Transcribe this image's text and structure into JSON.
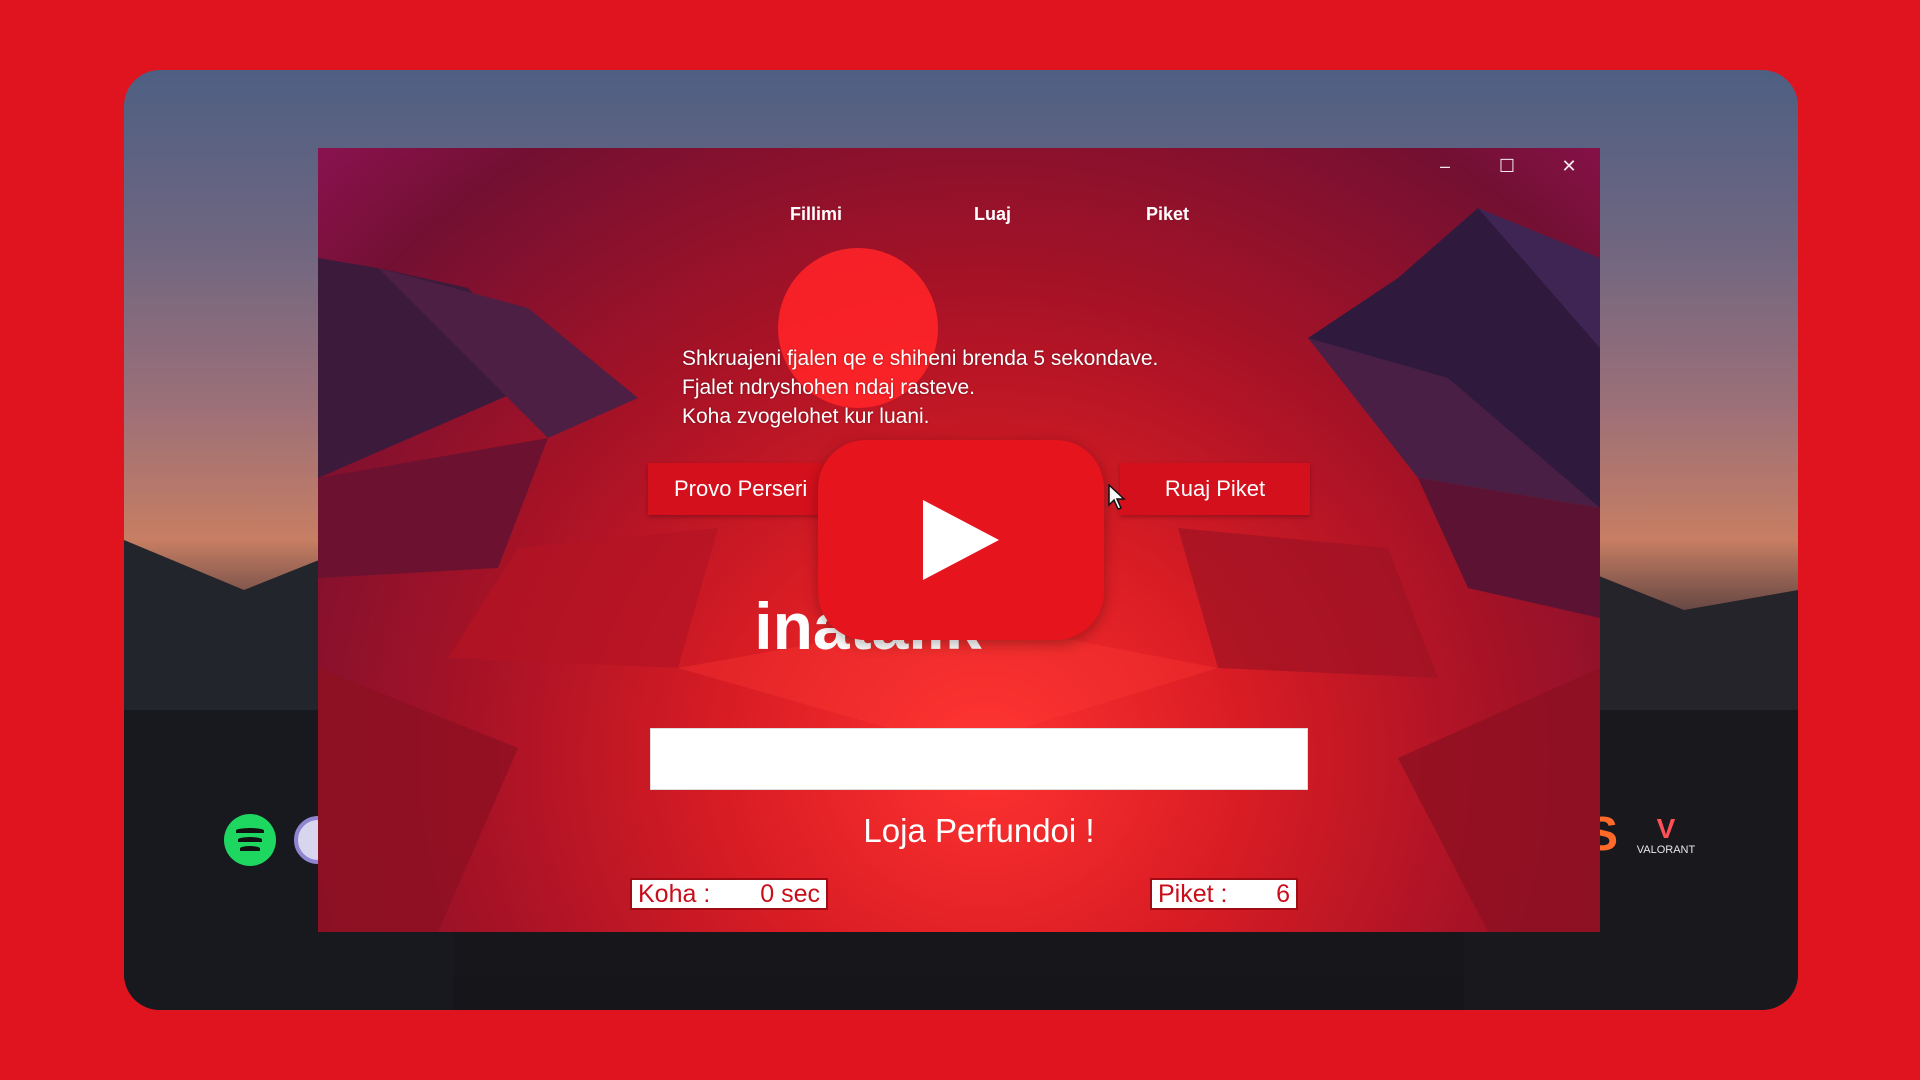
{
  "window": {
    "controls": {
      "minimize": "–",
      "maximize": "☐",
      "close": "✕"
    },
    "nav": [
      "Fillimi",
      "Luaj",
      "Piket"
    ]
  },
  "game": {
    "instructions": [
      "Shkruajeni fjalen qe e shiheni brenda 5 sekondave.",
      "Fjalet ndryshohen ndaj rasteve.",
      "Koha zvogelohet kur luani."
    ],
    "retry_label": "Provo Perseri",
    "save_label": "Ruaj Piket",
    "word": "inatalik",
    "input_value": "",
    "status": "Loja Perfundoi !",
    "time_label": "Koha :",
    "time_value": "0 sec",
    "score_label": "Piket :",
    "score_value": "6"
  },
  "desktop": {
    "icons": [
      "spotify-icon",
      "tor-browser-icon",
      "app-icon",
      "valorant-icon"
    ],
    "valorant_label": "VALORANT"
  },
  "overlay": {
    "icon": "youtube-play-icon"
  },
  "colors": {
    "frame_background": "#e0141f",
    "button_red": "#d4101c",
    "stat_text": "#c90d1a",
    "spotify_green": "#1ed760"
  }
}
